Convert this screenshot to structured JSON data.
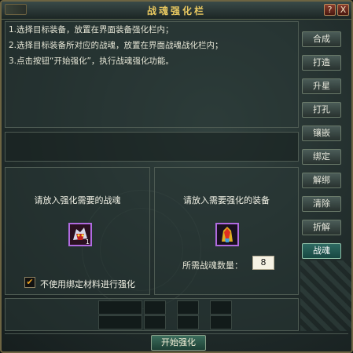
{
  "window": {
    "title": "战魂强化栏"
  },
  "title_buttons": {
    "help": "?",
    "close": "X"
  },
  "instructions": [
    "1.选择目标装备，放置在界面装备强化栏内；",
    "2.选择目标装备所对应的战魂，放置在界面战魂战化栏内；",
    "3.点击按钮“开始强化”，执行战魂强化功能。"
  ],
  "left_slot": {
    "label": "请放入强化需要的战魂",
    "item_count": "1"
  },
  "right_slot": {
    "label": "请放入需要强化的装备",
    "qty_label": "所需战魂数量：",
    "qty_value": "8"
  },
  "checkbox": {
    "label": "不使用绑定材料进行强化",
    "checked": true
  },
  "side_buttons": [
    "合成",
    "打造",
    "升星",
    "打孔",
    "镶嵌",
    "绑定",
    "解绑",
    "清除",
    "折解",
    "战魂"
  ],
  "active_side": "战魂",
  "start_button": "开始强化"
}
